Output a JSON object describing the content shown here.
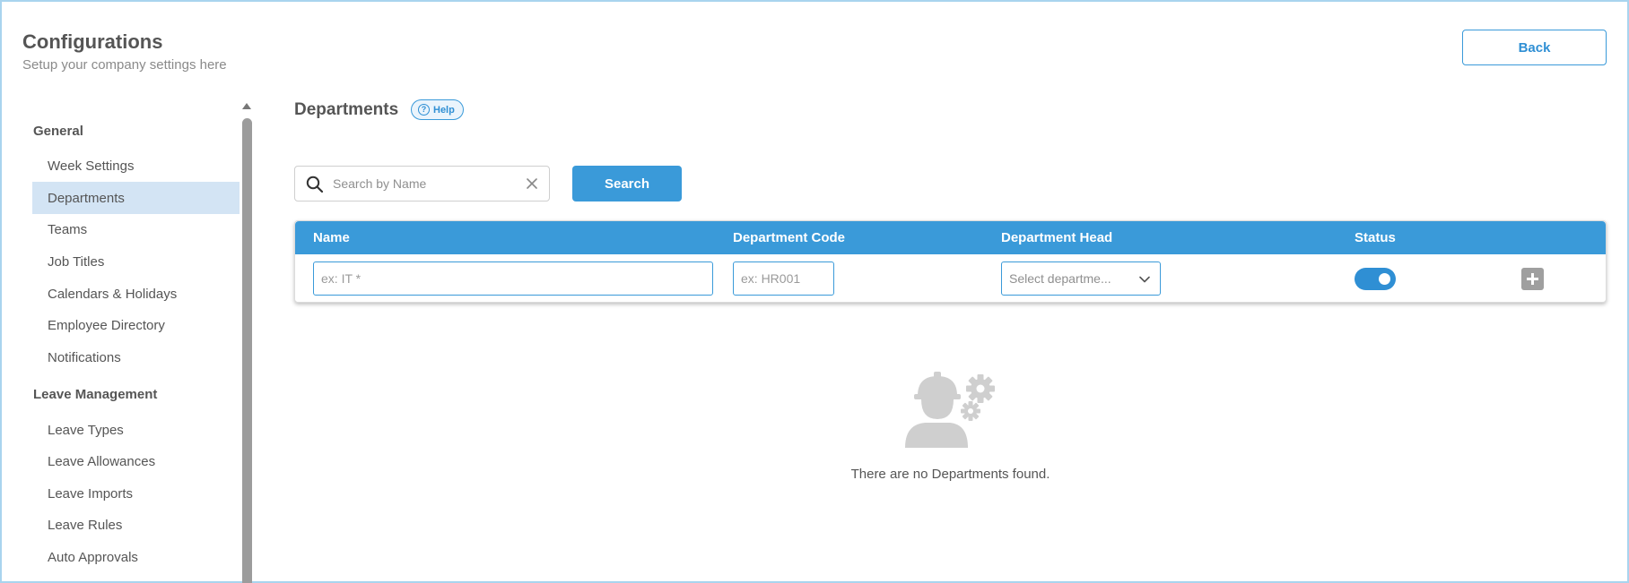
{
  "header": {
    "title": "Configurations",
    "subtitle": "Setup your company settings here",
    "back_label": "Back"
  },
  "sidebar": {
    "sections": [
      {
        "label": "General"
      },
      {
        "label": "Leave Management"
      }
    ],
    "items": [
      {
        "label": "Week Settings",
        "active": false
      },
      {
        "label": "Departments",
        "active": true
      },
      {
        "label": "Teams",
        "active": false
      },
      {
        "label": "Job Titles",
        "active": false
      },
      {
        "label": "Calendars & Holidays",
        "active": false
      },
      {
        "label": "Employee Directory",
        "active": false
      },
      {
        "label": "Notifications",
        "active": false
      },
      {
        "label": "Leave Types",
        "active": false
      },
      {
        "label": "Leave Allowances",
        "active": false
      },
      {
        "label": "Leave Imports",
        "active": false
      },
      {
        "label": "Leave Rules",
        "active": false
      },
      {
        "label": "Auto Approvals",
        "active": false
      }
    ]
  },
  "main": {
    "section_title": "Departments",
    "help_label": "Help",
    "search": {
      "placeholder": "Search by Name",
      "value": "",
      "button_label": "Search"
    },
    "table": {
      "columns": [
        "Name",
        "Department Code",
        "Department Head",
        "Status"
      ],
      "new_row": {
        "name_placeholder": "ex: IT *",
        "code_placeholder": "ex: HR001",
        "head_placeholder": "Select departme...",
        "status_on": true
      }
    },
    "empty_message": "There are no Departments found."
  },
  "colors": {
    "accent": "#3a9ad9",
    "active_nav": "#d3e4f4",
    "muted_icon": "#cfcfcf"
  },
  "icons": [
    "search-icon",
    "close-icon",
    "help-icon",
    "chevron-down-icon",
    "plus-icon",
    "worker-gears-icon"
  ]
}
